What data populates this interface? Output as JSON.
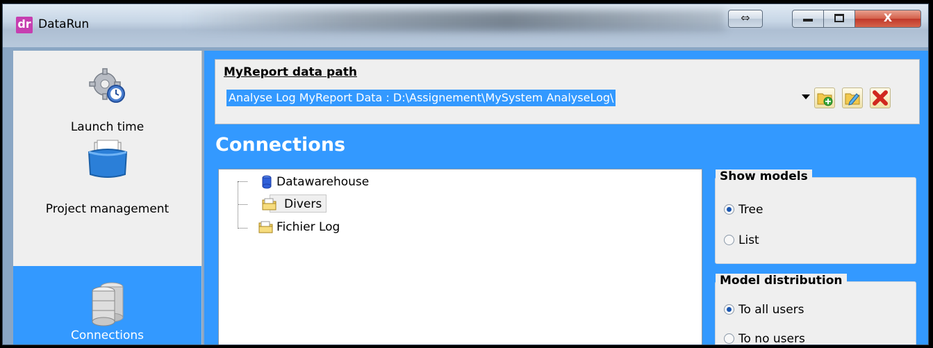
{
  "window": {
    "title": "DataRun",
    "logo_text": "dr",
    "resize_glyph": "⇔",
    "close_glyph": "X"
  },
  "sidebar": {
    "items": [
      {
        "label": "Launch time",
        "icon": "gear-clock-icon",
        "active": false
      },
      {
        "label": "Project management",
        "icon": "folders-box-icon",
        "active": false
      },
      {
        "label": "Connections",
        "icon": "database-icon",
        "active": true
      }
    ]
  },
  "data_path": {
    "title": "MyReport data path",
    "selected_value": "Analyse Log MyReport Data : D:\\Assignement\\MySystem AnalyseLog\\",
    "actions": [
      "add-folder-icon",
      "edit-icon",
      "delete-icon"
    ]
  },
  "connections": {
    "title": "Connections",
    "tree": [
      {
        "label": "Datawarehouse",
        "icon": "database-icon",
        "selected": false
      },
      {
        "label": "Divers",
        "icon": "folder-icon",
        "selected": true
      },
      {
        "label": "Fichier Log",
        "icon": "folder-icon",
        "selected": false
      }
    ]
  },
  "show_models": {
    "title": "Show models",
    "options": [
      {
        "label": "Tree",
        "checked": true
      },
      {
        "label": "List",
        "checked": false
      }
    ]
  },
  "model_distribution": {
    "title": "Model distribution",
    "options": [
      {
        "label": "To all users",
        "checked": true
      },
      {
        "label": "To no users",
        "checked": false
      }
    ]
  },
  "colors": {
    "accent": "#3399ff",
    "sidebar_bg": "#efefef",
    "close_red": "#c0392b"
  }
}
